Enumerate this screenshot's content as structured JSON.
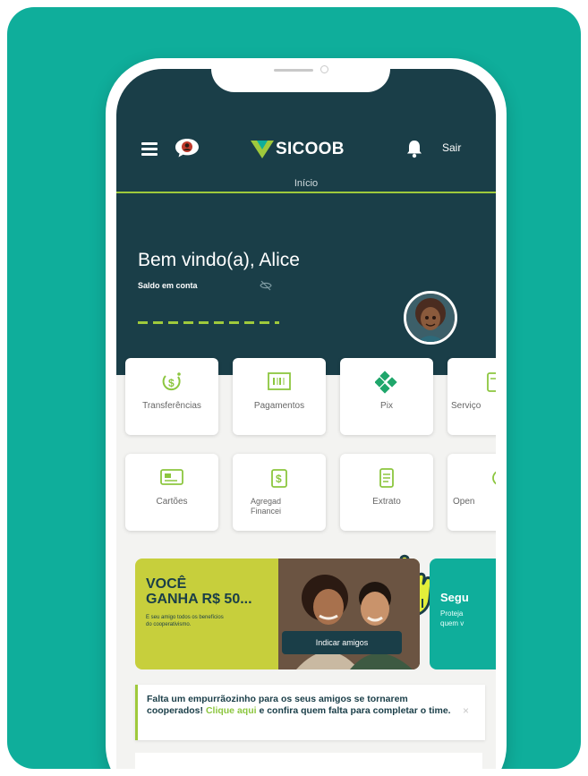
{
  "header": {
    "brand": "SICOOB",
    "logout_label": "Sair",
    "current_tab": "Início",
    "welcome": "Bem vindo(a), Alice",
    "balance_label": "Saldo em conta",
    "balance_hidden": true
  },
  "shortcuts": [
    {
      "label": "Transferências",
      "icon": "transfer-icon"
    },
    {
      "label": "Pagamentos",
      "icon": "barcode-icon"
    },
    {
      "label": "Pix",
      "icon": "pix-icon"
    },
    {
      "label": "Serviço",
      "icon": "services-icon"
    },
    {
      "label": "Cartões",
      "icon": "card-icon"
    },
    {
      "label": "Agregad Financei",
      "icon": "aggregator-icon"
    },
    {
      "label": "Extrato",
      "icon": "statement-icon"
    },
    {
      "label": "Open",
      "icon": "open-finance-icon"
    }
  ],
  "banner": {
    "title_line1": "VOCÊ",
    "title_line2": "GANHA R$ 50...",
    "small_text": "E seu amigo todos os benefícios do cooperativismo.",
    "button_label": "Indicar amigos"
  },
  "banner2": {
    "title": "Segu",
    "text_line1": "Proteja",
    "text_line2": "quem v"
  },
  "notice": {
    "text_before": "Falta um empurrãozinho para os seus amigos se tornarem cooperados! ",
    "link": "Clique aqui",
    "text_after": " e confira quem falta para completar o time.",
    "close": "×"
  },
  "colors": {
    "background": "#0fae9b",
    "header": "#1a3e48",
    "accent_green": "#9fc93c",
    "banner_yellow": "#c7cf3c"
  }
}
